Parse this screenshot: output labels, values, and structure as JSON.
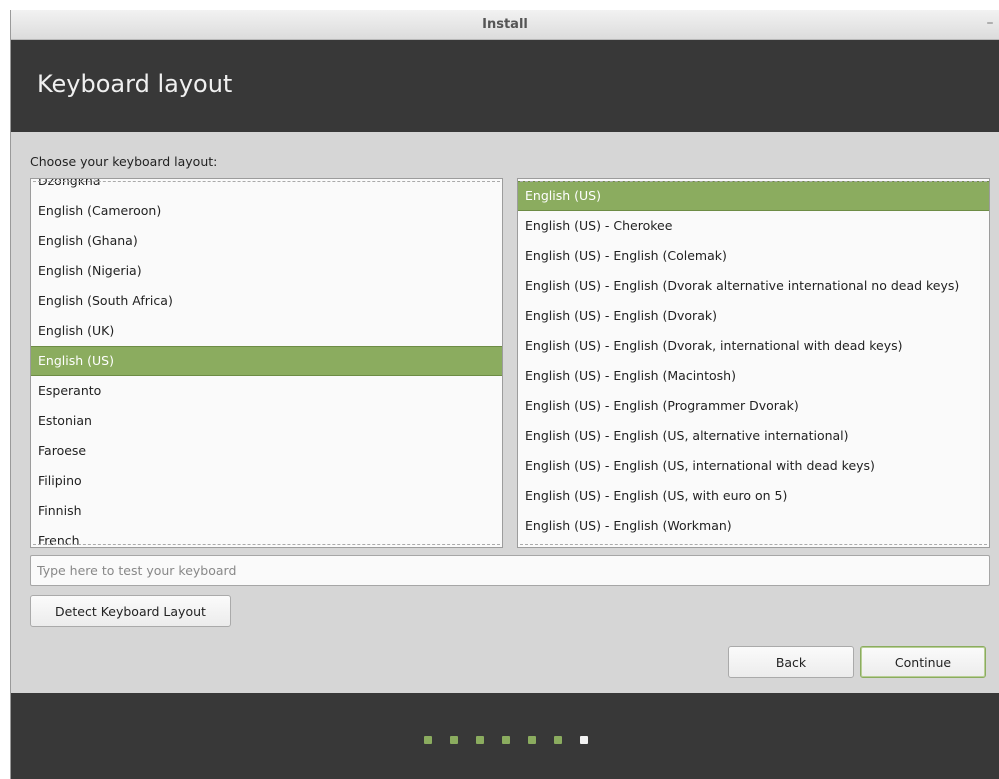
{
  "window": {
    "title": "Install",
    "minimize_glyph": "–"
  },
  "header": {
    "title": "Keyboard layout"
  },
  "main": {
    "prompt": "Choose your keyboard layout:",
    "layouts": [
      "Dzongkha",
      "English (Cameroon)",
      "English (Ghana)",
      "English (Nigeria)",
      "English (South Africa)",
      "English (UK)",
      "English (US)",
      "Esperanto",
      "Estonian",
      "Faroese",
      "Filipino",
      "Finnish",
      "French"
    ],
    "layouts_selected": "English (US)",
    "variants": [
      "English (US)",
      "English (US) - Cherokee",
      "English (US) - English (Colemak)",
      "English (US) - English (Dvorak alternative international no dead keys)",
      "English (US) - English (Dvorak)",
      "English (US) - English (Dvorak, international with dead keys)",
      "English (US) - English (Macintosh)",
      "English (US) - English (Programmer Dvorak)",
      "English (US) - English (US, alternative international)",
      "English (US) - English (US, international with dead keys)",
      "English (US) - English (US, with euro on 5)",
      "English (US) - English (Workman)"
    ],
    "variants_selected": "English (US)",
    "test_input": {
      "value": "",
      "placeholder": "Type here to test your keyboard"
    },
    "detect_button": "Detect Keyboard Layout"
  },
  "nav": {
    "back_label": "Back",
    "continue_label": "Continue"
  },
  "progress": {
    "total_steps": 7,
    "current_step": 7
  },
  "colors": {
    "accent": "#8bac5f",
    "header_bg": "#383838",
    "window_bg": "#d6d6d6"
  }
}
